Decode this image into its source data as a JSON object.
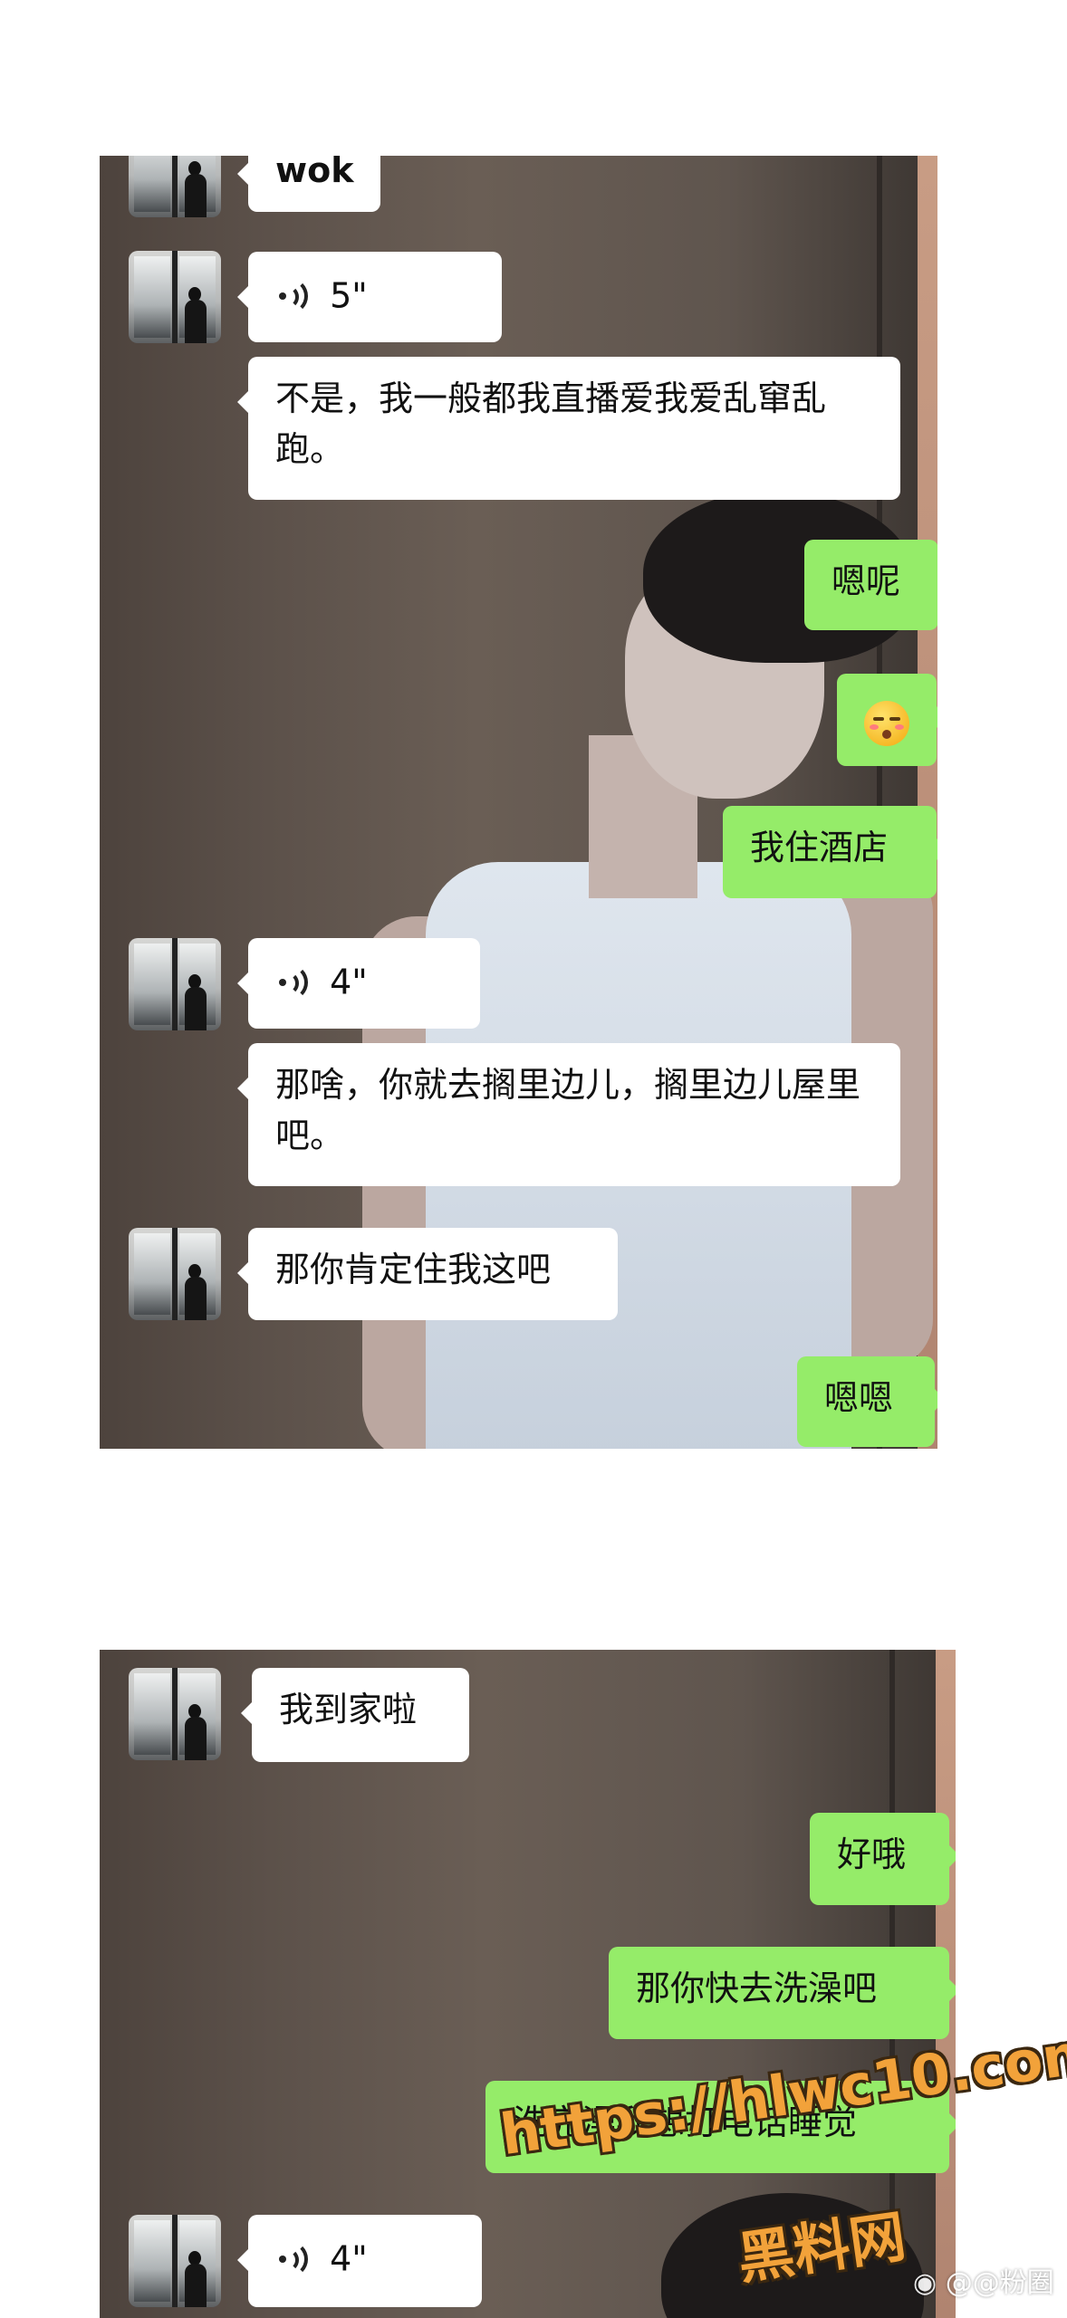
{
  "screenshot_1": {
    "messages": [
      {
        "side": "left",
        "type": "text",
        "text": "wok"
      },
      {
        "side": "left",
        "type": "voice",
        "duration": "5\""
      },
      {
        "side": "left",
        "type": "text",
        "text": "不是，我一般都我直播爱我爱乱窜乱跑。"
      },
      {
        "side": "right",
        "type": "text",
        "text": "嗯呢"
      },
      {
        "side": "right",
        "type": "emoji",
        "icon": "kissing-closed-eyes-emoji"
      },
      {
        "side": "right",
        "type": "text",
        "text": "我住酒店"
      },
      {
        "side": "left",
        "type": "voice",
        "duration": "4\""
      },
      {
        "side": "left",
        "type": "text",
        "text": "那啥，你就去搁里边儿，搁里边儿屋里吧。"
      },
      {
        "side": "left",
        "type": "text",
        "text": "那你肯定住我这吧"
      },
      {
        "side": "right",
        "type": "text",
        "text": "嗯嗯"
      }
    ]
  },
  "screenshot_2": {
    "messages": [
      {
        "side": "left",
        "type": "text",
        "text": "我到家啦"
      },
      {
        "side": "right",
        "type": "text",
        "text": "好哦"
      },
      {
        "side": "right",
        "type": "text",
        "text": "那你快去洗澡吧"
      },
      {
        "side": "right",
        "type": "text",
        "text": "洗完澡我想打电话睡觉"
      },
      {
        "side": "left",
        "type": "voice",
        "duration": "4\""
      }
    ]
  },
  "watermark": {
    "url": "https://hlwc10.com",
    "site_name": "黑料网",
    "weibo_handle": "@@粉圈"
  },
  "colors": {
    "bubble_incoming": "#ffffff",
    "bubble_outgoing": "#95ec69",
    "watermark": "#f2a23a"
  }
}
